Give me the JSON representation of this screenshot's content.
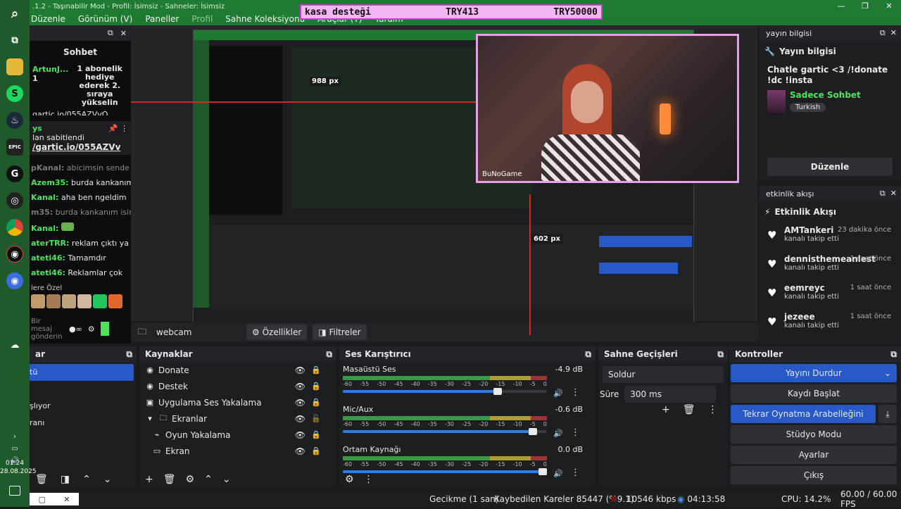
{
  "window": {
    "title": ".1.2 - Taşınabilir Mod - Profil: İsimsiz - Sahneler: İsimsiz",
    "controls": [
      "—",
      "❐",
      "✕"
    ]
  },
  "menu": {
    "items": [
      {
        "label": "Düzenle",
        "disabled": false
      },
      {
        "label": "Görünüm (V)",
        "disabled": false
      },
      {
        "label": "Paneller",
        "disabled": false
      },
      {
        "label": "Profil",
        "disabled": true
      },
      {
        "label": "Sahne Koleksiyonu",
        "disabled": false
      },
      {
        "label": "Araçlar (T)",
        "disabled": false
      },
      {
        "label": "Yardım",
        "disabled": false
      }
    ]
  },
  "banner": {
    "label": "kasa desteği",
    "value1": "TRY413",
    "value2": "TRY50000"
  },
  "chat": {
    "title": "Sohbet",
    "sub_user": "ArtunJ...",
    "sub_count": "1",
    "sub_text": "1 abonelik hediye ederek 2. sıraya yükselin",
    "cut_line": "gartic.io/055AZVvO",
    "pinned_user": "ys",
    "pinned_label": "lan sabitlendi",
    "pinned_link": "/gartic.io/055AZVv",
    "messages": [
      {
        "user": "pKanal:",
        "text": "abicimsin sende isi...",
        "color": "#7a7a7a"
      },
      {
        "user": "Azem35:",
        "text": "burda kankanım",
        "color": "#4ee35b"
      },
      {
        "user": "Kanal:",
        "text": "aha ben ngeldim",
        "color": "#4ee35b"
      },
      {
        "user": "m35:",
        "text": "burda kankanım isimli ...",
        "color": "#7a7a7a"
      },
      {
        "user": "Kanal:",
        "text": "",
        "color": "#4ee35b"
      },
      {
        "user": "aterTRR:",
        "text": "reklam çıktı ya",
        "color": "#4ee35b"
      },
      {
        "user": "ateti46:",
        "text": "Tamamdır",
        "color": "#4ee35b"
      },
      {
        "user": "ateti46:",
        "text": "Reklamlar çok",
        "color": "#4ee35b"
      }
    ],
    "emote_section": "lere Özel",
    "input_placeholder": "Bir mesaj gönderin"
  },
  "preview": {
    "webcam_label": "BuNoGame",
    "px_label_1": "988 px",
    "px_label_2": "602 px"
  },
  "source_bar": {
    "name": "webcam",
    "properties": "Özellikler",
    "filters": "Filtreler"
  },
  "info_dock": {
    "header": "yayın bilgisi",
    "section": "Yayın bilgisi",
    "stream_title": "Chatle gartic <3 /!donate !dc !insta",
    "category": "Sadece Sohbet",
    "tag": "Turkish",
    "edit_button": "Düzenle"
  },
  "event_dock": {
    "header": "etkinlik akışı",
    "section": "Etkinlik Akışı",
    "events": [
      {
        "name": "AMTankeri",
        "action": "kanalı takip etti",
        "time": "23 dakika önce"
      },
      {
        "name": "dennisthemeanlest",
        "action": "kanalı takip etti",
        "time": "1 saat önce"
      },
      {
        "name": "eemreyc",
        "action": "kanalı takip etti",
        "time": "1 saat önce"
      },
      {
        "name": "jezeee",
        "action": "kanalı takip etti",
        "time": "1 saat önce"
      }
    ]
  },
  "scenes": {
    "header": "ar",
    "items": [
      {
        "label": "tü",
        "selected": true
      },
      {
        "label": "",
        "selected": false
      },
      {
        "label": "şlıyor",
        "selected": false
      },
      {
        "label": "ranı",
        "selected": false
      }
    ]
  },
  "sources": {
    "header": "Kaynaklar",
    "items": [
      {
        "label": "Donate",
        "icon": "◉",
        "indent": 0
      },
      {
        "label": "Destek",
        "icon": "◉",
        "indent": 0
      },
      {
        "label": "Uygulama Ses Yakalama",
        "icon": "▣",
        "indent": 0
      },
      {
        "label": "Ekranlar",
        "icon": "▾ ▭",
        "indent": 0
      },
      {
        "label": "Oyun Yakalama",
        "icon": "⌁",
        "indent": 1
      },
      {
        "label": "Ekran",
        "icon": "▭",
        "indent": 1
      }
    ]
  },
  "mixer": {
    "header": "Ses Karıştırıcı",
    "ticks": [
      "-60",
      "-55",
      "-50",
      "-45",
      "-40",
      "-35",
      "-30",
      "-25",
      "-20",
      "-15",
      "-10",
      "-5",
      "0"
    ],
    "channels": [
      {
        "name": "Masaüstü Ses",
        "db": "-4.9 dB",
        "volume": 0.78
      },
      {
        "name": "Mic/Aux",
        "db": "-0.6 dB",
        "volume": 0.95
      },
      {
        "name": "Ortam Kaynağı",
        "db": "0.0 dB",
        "volume": 1.0
      }
    ]
  },
  "transitions": {
    "header": "Sahne Geçişleri",
    "selected": "Soldur",
    "duration_label": "Süre",
    "duration_value": "300 ms"
  },
  "controls": {
    "header": "Kontroller",
    "stop_stream": "Yayını Durdur",
    "start_record": "Kaydı Başlat",
    "stop_replay": "Tekrar Oynatma Arabelleğini Durdur",
    "studio_mode": "Stüdyo Modu",
    "settings": "Ayarlar",
    "exit": "Çıkış"
  },
  "status": {
    "delay": "Gecikme (1 san)",
    "dropped": "Kaybedilen Kareler 85447 (%9.1)",
    "bitrate": "10546 kbps",
    "time": "04:13:58",
    "cpu": "CPU: 14.2%",
    "fps": "60.00 / 60.00 FPS"
  },
  "taskbar": {
    "clock_time": "01:24",
    "clock_date": "28.08.2025"
  },
  "colors": {
    "accent_blue": "#2759c9",
    "obs_green": "#1d7a30",
    "twitch_green": "#4ee35b"
  }
}
